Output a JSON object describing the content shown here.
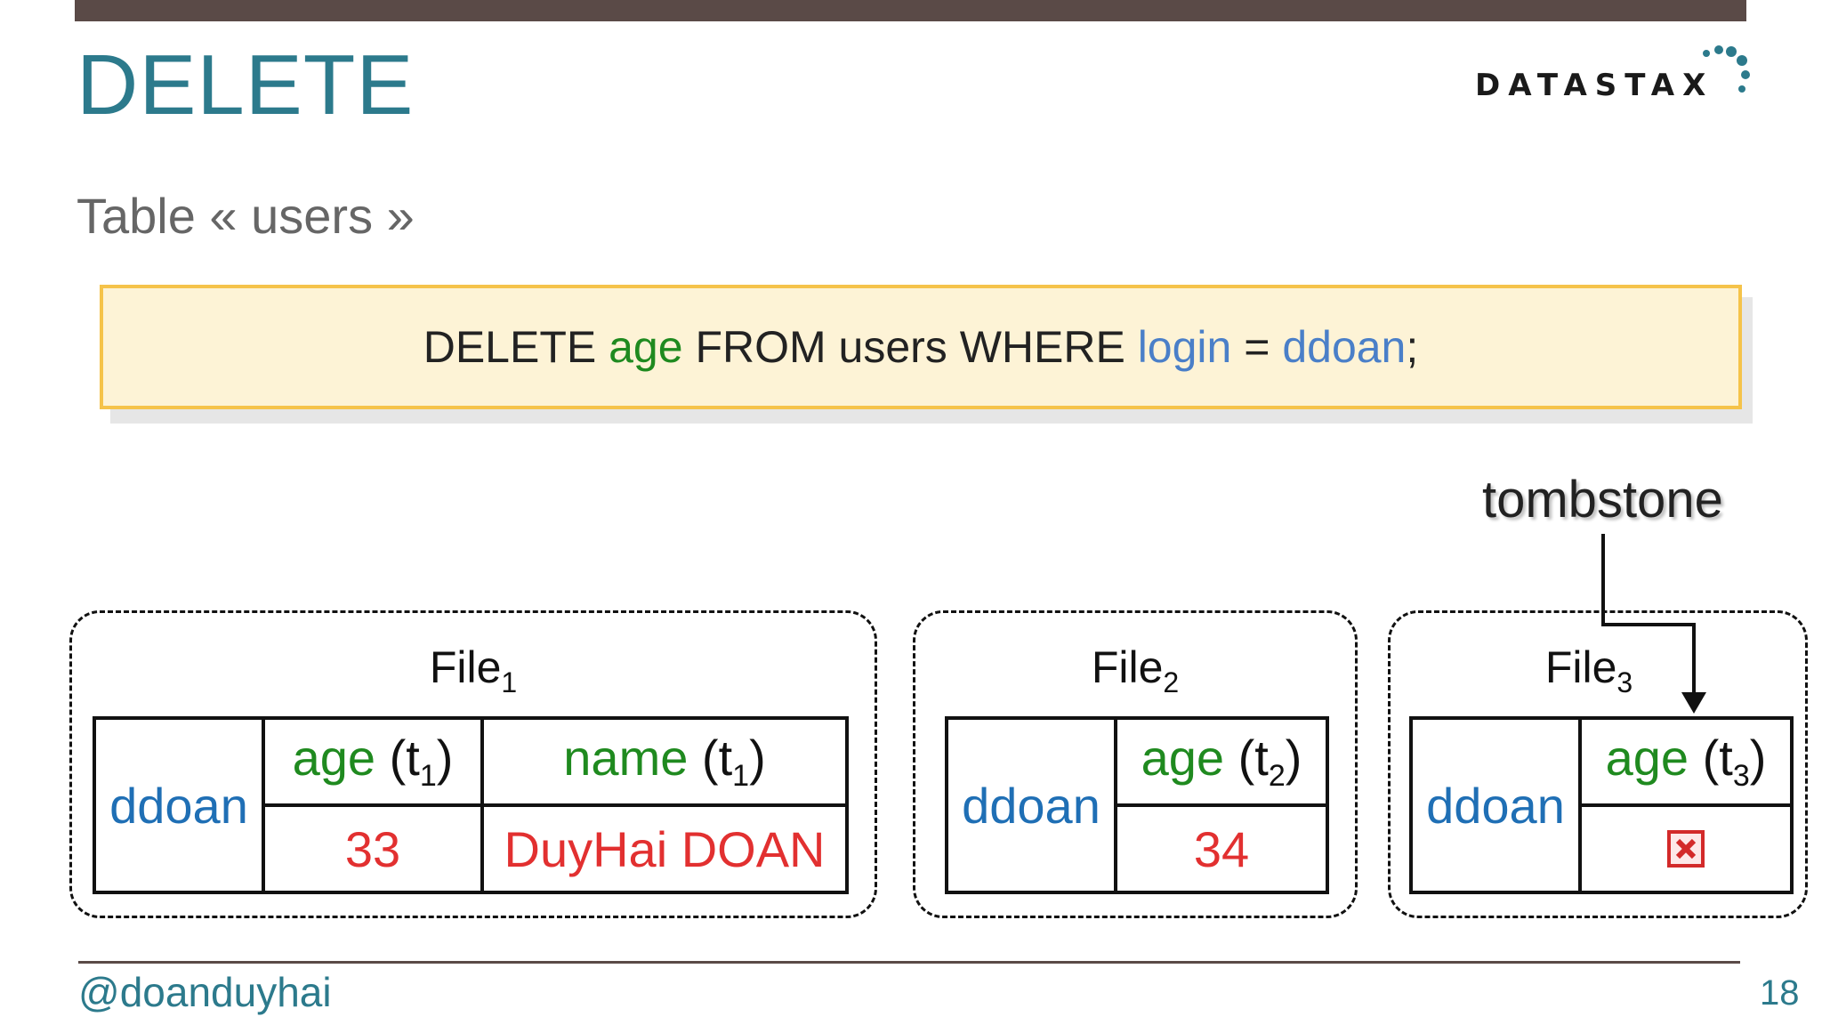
{
  "slide": {
    "title": "DELETE",
    "subtitle": "Table « users »",
    "logo_text": "DATASTAX",
    "query": {
      "prefix": "DELETE ",
      "column": "age",
      "mid": " FROM users WHERE ",
      "key_col": "login",
      "eq": " = ",
      "key_val": "ddoan",
      "suffix": ";"
    },
    "tombstone_label": "tombstone",
    "files": [
      {
        "label": "File",
        "index": "1",
        "key": "ddoan",
        "columns": [
          {
            "name": "age",
            "ts_open": " (t",
            "ts": "1",
            "ts_close": ")",
            "value": "33"
          },
          {
            "name": "name",
            "ts_open": " (t",
            "ts": "1",
            "ts_close": ")",
            "value": "DuyHai DOAN"
          }
        ]
      },
      {
        "label": "File",
        "index": "2",
        "key": "ddoan",
        "columns": [
          {
            "name": "age",
            "ts_open": " (t",
            "ts": "2",
            "ts_close": ")",
            "value": "34"
          }
        ]
      },
      {
        "label": "File",
        "index": "3",
        "key": "ddoan",
        "columns": [
          {
            "name": "age",
            "ts_open": " (t",
            "ts": "3",
            "ts_close": ")",
            "value_icon": "tombstone-x-icon"
          }
        ]
      }
    ],
    "footer": {
      "handle": "@doanduyhai",
      "page": "18"
    }
  }
}
